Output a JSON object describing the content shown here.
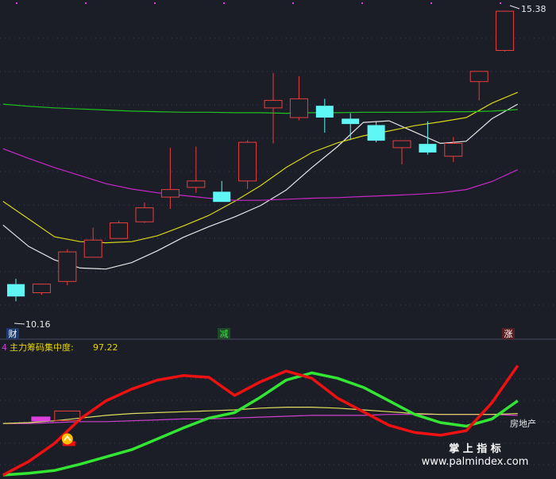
{
  "colors": {
    "background": "#1b1d27",
    "grid": "#3a3f55",
    "up_candle": "#e8403f",
    "down_candle": "#5ff6f6",
    "ma_white": "#e6e6e6",
    "ma_yellow": "#d8d81a",
    "ma_green": "#20c020",
    "ma_magenta": "#c829c8",
    "red_line": "#ee1111",
    "green_line": "#33e633",
    "yellow_line": "#e0e060",
    "magenta_line": "#d040d0",
    "label_text": "#e8e8e8",
    "indicator_title": "#e6d600",
    "indicator_index": "#d040d0"
  },
  "annotations": {
    "high_label": "15.38",
    "low_label": "10.16",
    "marker_cai": "财",
    "marker_jian": "减",
    "marker_zhang": "涨",
    "sector_label": "房地产"
  },
  "indicator": {
    "index": "4",
    "title": "主力筹码集中度:",
    "value": "97.22"
  },
  "watermark": {
    "line1": "掌 上 指 标",
    "line2": "www.palmindex.com"
  },
  "chart_data": [
    {
      "type": "candlestick",
      "title": "",
      "ylim": [
        9.6,
        15.5
      ],
      "grid": true,
      "candles": [
        {
          "open": 10.3,
          "close": 10.07,
          "high": 10.4,
          "low": 9.98
        },
        {
          "open": 10.14,
          "close": 10.3,
          "high": 10.3,
          "low": 10.1
        },
        {
          "open": 10.35,
          "close": 10.9,
          "high": 10.95,
          "low": 10.28
        },
        {
          "open": 10.8,
          "close": 11.12,
          "high": 11.35,
          "low": 10.8
        },
        {
          "open": 11.15,
          "close": 11.44,
          "high": 11.48,
          "low": 11.15
        },
        {
          "open": 11.46,
          "close": 11.72,
          "high": 11.82,
          "low": 11.44
        },
        {
          "open": 11.92,
          "close": 12.06,
          "high": 12.84,
          "low": 11.7
        },
        {
          "open": 12.1,
          "close": 12.22,
          "high": 12.86,
          "low": 12.0
        },
        {
          "open": 12.02,
          "close": 11.83,
          "high": 12.22,
          "low": 11.83
        },
        {
          "open": 12.22,
          "close": 12.94,
          "high": 12.98,
          "low": 12.07
        },
        {
          "open": 13.58,
          "close": 13.72,
          "high": 14.23,
          "low": 12.92
        },
        {
          "open": 13.4,
          "close": 13.75,
          "high": 14.17,
          "low": 13.35
        },
        {
          "open": 13.62,
          "close": 13.4,
          "high": 13.75,
          "low": 13.12
        },
        {
          "open": 13.38,
          "close": 13.28,
          "high": 13.48,
          "low": 12.98
        },
        {
          "open": 13.26,
          "close": 12.97,
          "high": 13.32,
          "low": 12.94
        },
        {
          "open": 12.84,
          "close": 12.97,
          "high": 12.97,
          "low": 12.53
        },
        {
          "open": 12.91,
          "close": 12.75,
          "high": 13.33,
          "low": 12.71
        },
        {
          "open": 12.68,
          "close": 12.92,
          "high": 13.04,
          "low": 12.57
        },
        {
          "open": 14.07,
          "close": 14.26,
          "high": 14.26,
          "low": 13.72
        },
        {
          "open": 14.65,
          "close": 15.38,
          "high": 15.38,
          "low": 14.63
        }
      ],
      "series": [
        {
          "name": "",
          "color": "#e6e6e6",
          "values": [
            11.4,
            11.0,
            10.75,
            10.6,
            10.58,
            10.7,
            10.92,
            11.17,
            11.37,
            11.55,
            11.76,
            12.05,
            12.47,
            12.86,
            13.31,
            13.34,
            13.13,
            12.92,
            12.96,
            13.38,
            13.65
          ]
        },
        {
          "name": "",
          "color": "#d8d81a",
          "values": [
            11.84,
            11.51,
            11.18,
            11.09,
            11.07,
            11.09,
            11.2,
            11.38,
            11.58,
            11.84,
            12.13,
            12.47,
            12.75,
            12.93,
            13.06,
            13.15,
            13.25,
            13.32,
            13.4,
            13.67,
            13.87
          ]
        },
        {
          "name": "",
          "color": "#20c020",
          "values": [
            13.65,
            13.61,
            13.58,
            13.56,
            13.54,
            13.52,
            13.51,
            13.5,
            13.5,
            13.49,
            13.49,
            13.48,
            13.49,
            13.49,
            13.5,
            13.5,
            13.5,
            13.51,
            13.51,
            13.52,
            13.55
          ]
        },
        {
          "name": "",
          "color": "#c829c8",
          "values": [
            12.82,
            12.64,
            12.47,
            12.32,
            12.17,
            12.07,
            12.0,
            11.95,
            11.9,
            11.86,
            11.86,
            11.88,
            11.9,
            11.91,
            11.93,
            11.95,
            11.97,
            12.0,
            12.06,
            12.21,
            12.43
          ]
        }
      ]
    },
    {
      "type": "line",
      "title": "主力筹码集中度",
      "ylim": [
        0,
        130
      ],
      "grid": true,
      "series": [
        {
          "name": "",
          "color": "#ee1111",
          "values": [
            0,
            15,
            35,
            62,
            82,
            95,
            105,
            110,
            108,
            88,
            103,
            115,
            107,
            85,
            70,
            55,
            47,
            44,
            49,
            80,
            121
          ]
        },
        {
          "name": "",
          "color": "#33e633",
          "values": [
            0,
            2,
            5,
            12,
            20,
            28,
            40,
            52,
            63,
            69,
            86,
            105,
            113,
            107,
            97,
            82,
            67,
            58,
            54,
            62,
            82
          ]
        },
        {
          "name": "",
          "color": "#e0e060",
          "values": [
            57,
            58,
            60,
            63,
            66,
            68,
            69,
            70,
            71,
            72,
            74,
            75,
            75,
            74,
            72,
            70,
            68,
            67,
            67,
            67,
            68
          ]
        },
        {
          "name": "",
          "color": "#d040d0",
          "values": [
            57,
            57,
            58,
            59,
            59,
            60,
            61,
            62,
            62,
            63,
            64,
            65,
            66,
            66,
            66,
            67,
            67,
            67,
            67,
            67,
            66
          ]
        }
      ],
      "markers": [
        {
          "kind": "bar",
          "x": 1,
          "y": 62,
          "color": "#e040e0"
        },
        {
          "kind": "box",
          "x": 2,
          "y": 62,
          "color": "#e8403f"
        },
        {
          "kind": "dot",
          "x": 2,
          "y": 40,
          "color": "#ffc000"
        }
      ]
    }
  ]
}
